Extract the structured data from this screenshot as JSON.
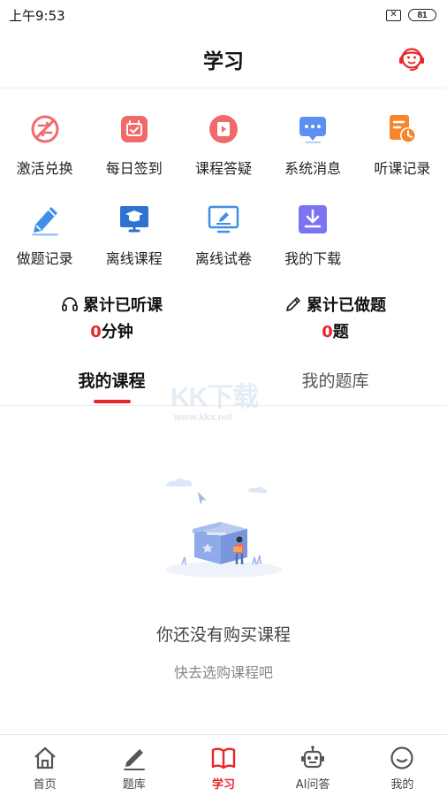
{
  "status_bar": {
    "time": "上午9:53",
    "battery": "81"
  },
  "header": {
    "title": "学习"
  },
  "grid": {
    "items": [
      {
        "label": "激活兑换",
        "icon": "activate-exchange-icon",
        "color": "#f06a6a"
      },
      {
        "label": "每日签到",
        "icon": "calendar-checkin-icon",
        "color": "#f06a6a"
      },
      {
        "label": "课程答疑",
        "icon": "video-qa-icon",
        "color": "#f06a6a"
      },
      {
        "label": "系统消息",
        "icon": "message-icon",
        "color": "#5b8ff0"
      },
      {
        "label": "听课记录",
        "icon": "record-clock-icon",
        "color": "#f5862d"
      },
      {
        "label": "做题记录",
        "icon": "pencil-record-icon",
        "color": "#3f8fe6"
      },
      {
        "label": "离线课程",
        "icon": "offline-course-icon",
        "color": "#2f72d2"
      },
      {
        "label": "离线试卷",
        "icon": "offline-paper-icon",
        "color": "#3f8fe6"
      },
      {
        "label": "我的下载",
        "icon": "download-icon",
        "color": "#7b74f2"
      }
    ]
  },
  "stats": {
    "listen": {
      "title": "累计已听课",
      "value": "0",
      "unit": "分钟"
    },
    "practice": {
      "title": "累计已做题",
      "value": "0",
      "unit": "题"
    }
  },
  "tabs": [
    {
      "label": "我的课程",
      "active": true
    },
    {
      "label": "我的题库",
      "active": false
    }
  ],
  "watermark": {
    "main": "KK下载",
    "sub": "www.kkx.net"
  },
  "empty": {
    "title": "你还没有购买课程",
    "subtitle": "快去选购课程吧"
  },
  "bottom_nav": [
    {
      "label": "首页",
      "icon": "home-icon"
    },
    {
      "label": "题库",
      "icon": "question-bank-icon"
    },
    {
      "label": "学习",
      "icon": "study-book-icon",
      "active": true
    },
    {
      "label": "AI问答",
      "icon": "robot-icon"
    },
    {
      "label": "我的",
      "icon": "profile-icon"
    }
  ],
  "colors": {
    "accent": "#e8262d",
    "text": "#111111",
    "muted": "#888888"
  }
}
